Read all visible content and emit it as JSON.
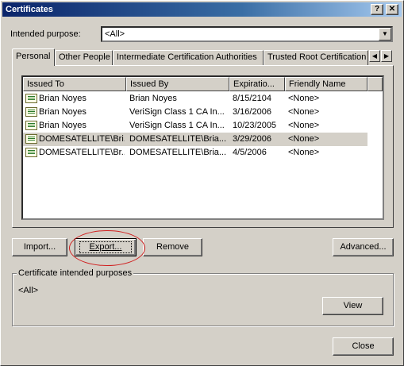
{
  "window": {
    "title": "Certificates",
    "help_button": "?",
    "close_button": "✕"
  },
  "purpose": {
    "label": "Intended purpose:",
    "value": "<All>"
  },
  "tabs": [
    {
      "label": "Personal"
    },
    {
      "label": "Other People"
    },
    {
      "label": "Intermediate Certification Authorities"
    },
    {
      "label": "Trusted Root Certification"
    }
  ],
  "table": {
    "columns": [
      "Issued To",
      "Issued By",
      "Expiratio...",
      "Friendly Name"
    ],
    "rows": [
      {
        "issued_to": "Brian Noyes",
        "issued_by": "Brian Noyes",
        "expiration": "8/15/2104",
        "friendly": "<None>"
      },
      {
        "issued_to": "Brian Noyes",
        "issued_by": "VeriSign Class 1 CA In...",
        "expiration": "3/16/2006",
        "friendly": "<None>"
      },
      {
        "issued_to": "Brian Noyes",
        "issued_by": "VeriSign Class 1 CA In...",
        "expiration": "10/23/2005",
        "friendly": "<None>"
      },
      {
        "issued_to": "DOMESATELLITE\\Bri...",
        "issued_by": "DOMESATELLITE\\Bria...",
        "expiration": "3/29/2006",
        "friendly": "<None>"
      },
      {
        "issued_to": "DOMESATELLITE\\Br...",
        "issued_by": "DOMESATELLITE\\Bria...",
        "expiration": "4/5/2006",
        "friendly": "<None>"
      }
    ]
  },
  "buttons": {
    "import": "Import...",
    "export": "Export...",
    "remove": "Remove",
    "advanced": "Advanced...",
    "view": "View",
    "close": "Close"
  },
  "purposes_group": {
    "title": "Certificate intended purposes",
    "value": "<All>"
  },
  "colors": {
    "titlebar": "#0a246a",
    "face": "#d4d0c8",
    "annotation": "#d02020"
  }
}
